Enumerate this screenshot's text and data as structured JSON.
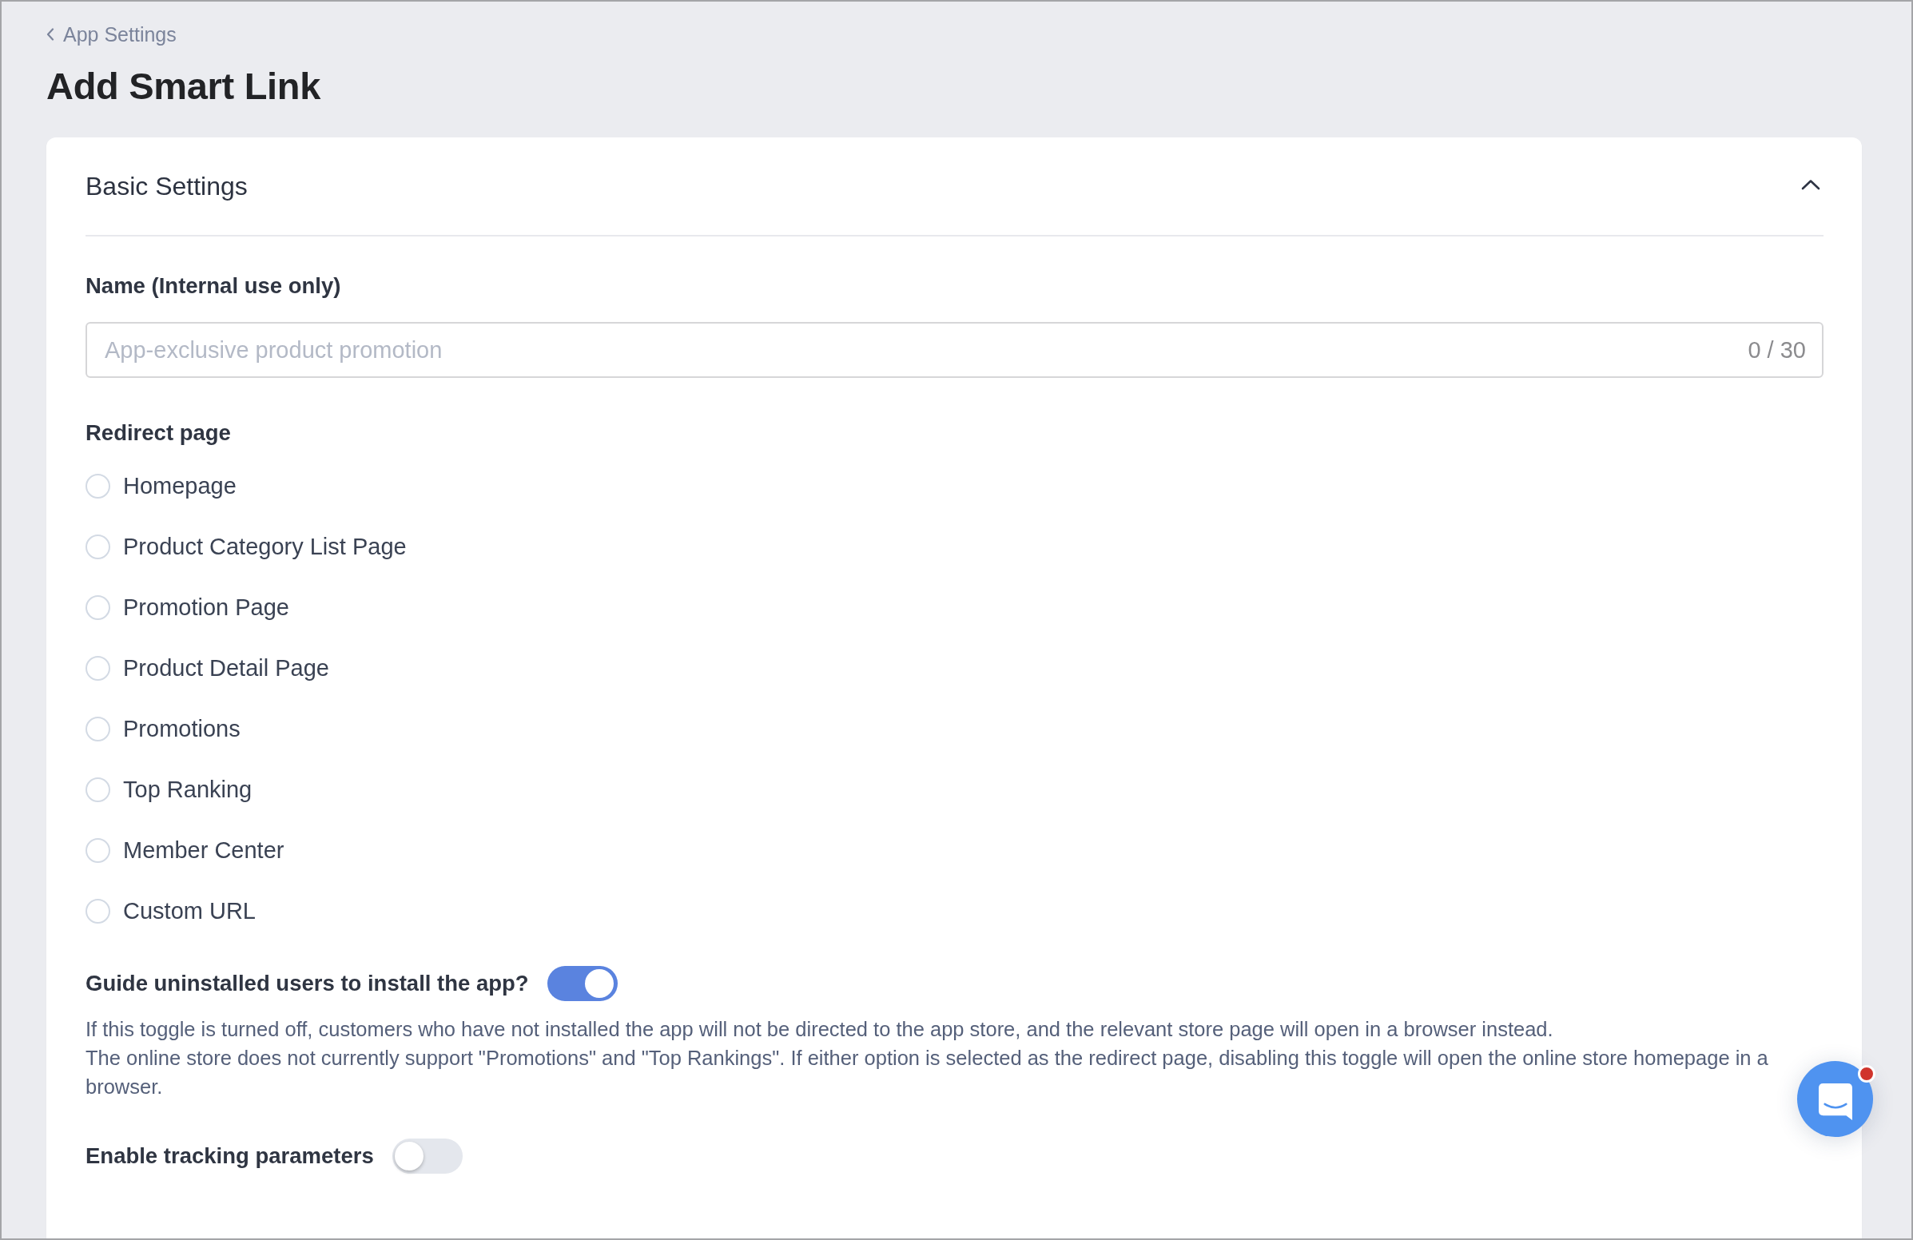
{
  "breadcrumb": {
    "label": "App Settings"
  },
  "page_title": "Add Smart Link",
  "section": {
    "title": "Basic Settings",
    "expanded": true,
    "name_field": {
      "label": "Name (Internal use only)",
      "placeholder": "App-exclusive product promotion",
      "counter": "0 / 30"
    },
    "redirect": {
      "label": "Redirect page",
      "options": [
        {
          "label": "Homepage",
          "selected": false
        },
        {
          "label": "Product Category List Page",
          "selected": false
        },
        {
          "label": "Promotion Page",
          "selected": false
        },
        {
          "label": "Product Detail Page",
          "selected": false
        },
        {
          "label": "Promotions",
          "selected": false
        },
        {
          "label": "Top Ranking",
          "selected": false
        },
        {
          "label": "Member Center",
          "selected": false
        },
        {
          "label": "Custom URL",
          "selected": false
        }
      ]
    },
    "install_guide": {
      "label": "Guide uninstalled users to install the app?",
      "on": true,
      "notes": [
        "If this toggle is turned off, customers who have not installed the app will not be directed to the app store, and the relevant store page will open in a browser instead.",
        "The online store does not currently support \"Promotions\" and \"Top Rankings\". If either option is selected as the redirect page, disabling this toggle will open the online store homepage in a browser."
      ]
    },
    "tracking": {
      "label": "Enable tracking parameters",
      "on": false
    }
  },
  "chat_widget": {
    "unread": true
  }
}
